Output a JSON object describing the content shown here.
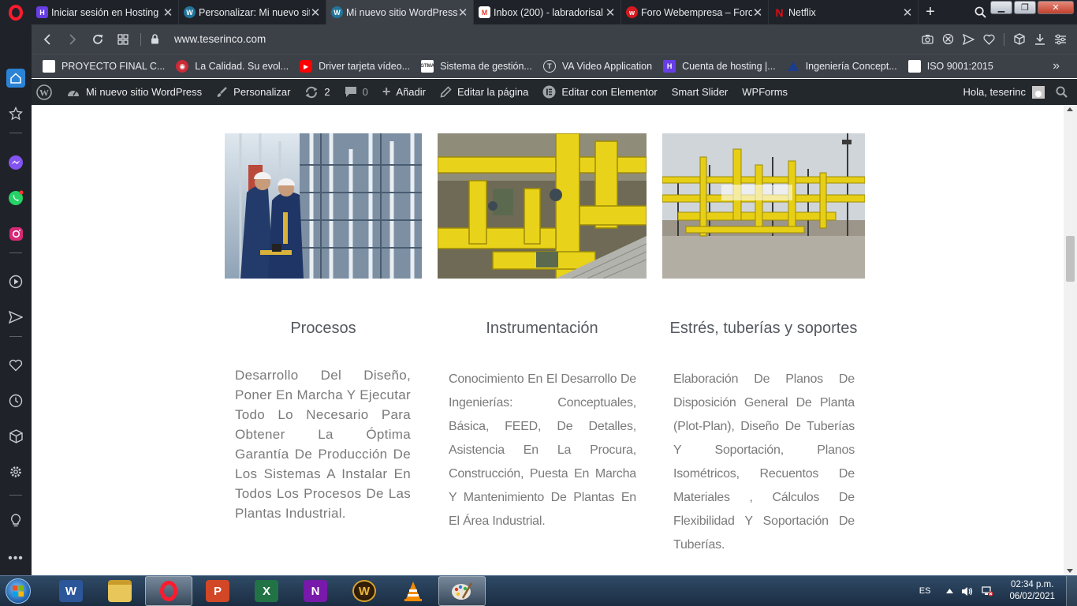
{
  "browser": {
    "tabs": [
      {
        "title": "Iniciar sesión en Hosting",
        "icon": "hostinger-icon",
        "color": "#673de6",
        "active": false
      },
      {
        "title": "Personalizar: Mi nuevo sitio",
        "icon": "wordpress-icon",
        "color": "#21759b",
        "active": false
      },
      {
        "title": "Mi nuevo sitio WordPress",
        "icon": "wordpress-icon",
        "color": "#21759b",
        "active": true
      },
      {
        "title": "Inbox (200) - labradorisal",
        "icon": "gmail-icon",
        "color": "#ea4335",
        "active": false
      },
      {
        "title": "Foro Webempresa – Foro",
        "icon": "webempresa-icon",
        "color": "#d7191f",
        "active": false
      },
      {
        "title": "Netflix",
        "icon": "netflix-icon",
        "color": "#e50914",
        "active": false
      }
    ],
    "url": "www.teserinco.com",
    "bookmarks": [
      {
        "label": "PROYECTO FINAL C...",
        "icon": "page-icon"
      },
      {
        "label": "La Calidad. Su evol...",
        "icon": "site-icon"
      },
      {
        "label": "Driver tarjeta vídeo...",
        "icon": "youtube-icon"
      },
      {
        "label": "Sistema de gestión...",
        "icon": "site-icon"
      },
      {
        "label": "VA Video Application",
        "icon": "site-icon"
      },
      {
        "label": "Cuenta de hosting |...",
        "icon": "hostinger-icon"
      },
      {
        "label": "Ingeniería Concept...",
        "icon": "triangle-icon"
      },
      {
        "label": "ISO 9001:2015",
        "icon": "page-icon"
      }
    ],
    "bookmarks_more": "»"
  },
  "wp_admin_bar": {
    "site_name": "Mi nuevo sitio WordPress",
    "customize": "Personalizar",
    "updates_count": "2",
    "comments_count": "0",
    "add_new": "Añadir",
    "edit_page": "Editar la página",
    "edit_elementor": "Editar con Elementor",
    "smart_slider": "Smart Slider",
    "wpforms": "WPForms",
    "greeting": "Hola, teserinc"
  },
  "services": [
    {
      "title": "Procesos",
      "description": "Desarrollo Del Diseño, Poner En Marcha Y Ejecutar Todo Lo Necesario Para Obtener La Óptima Garantía De Producción De Los Sistemas A Instalar En Todos Los Procesos De Las Plantas Industrial."
    },
    {
      "title": "Instrumentación",
      "description": "Conocimiento En El Desarrollo De Ingenierías: Conceptuales, Básica, FEED, De Detalles, Asistencia En La Procura, Construcción, Puesta En Marcha Y Mantenimiento De Plantas En El Área Industrial."
    },
    {
      "title": "Estrés, tuberías y soportes",
      "description": "Elaboración De Planos De Disposición General De Planta (Plot-Plan), Diseño De Tuberías Y Soportación, Planos Isométricos, Recuentos De Materiales , Cálculos De Flexibilidad Y Soportación De Tuberías."
    }
  ],
  "taskbar": {
    "apps": [
      "word-icon",
      "file-explorer-icon",
      "opera-icon",
      "powerpoint-icon",
      "excel-icon",
      "onenote-icon",
      "world-of-warcraft-icon",
      "vlc-icon",
      "paint-icon"
    ],
    "language": "ES",
    "time": "02:34 p.m.",
    "date": "06/02/2021"
  }
}
